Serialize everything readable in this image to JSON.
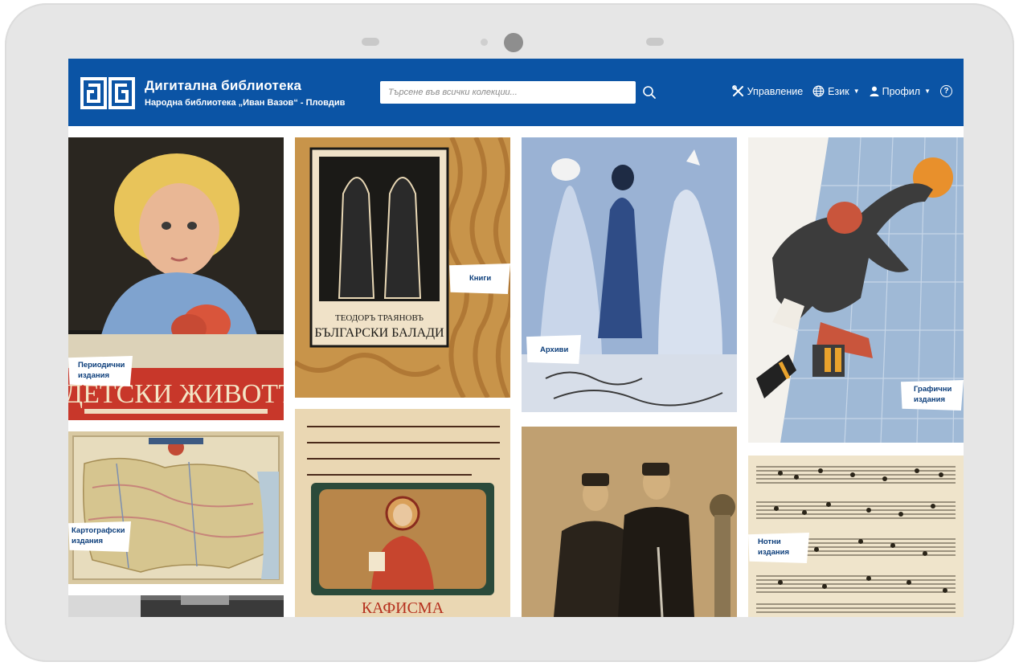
{
  "header": {
    "title": "Дигитална библиотека",
    "subtitle": "Народна библиотека „Иван Вазов“ - Пловдив",
    "search_placeholder": "Търсене във всички колекции...",
    "menu": {
      "manage": "Управление",
      "language": "Език",
      "profile": "Профил",
      "help": "?"
    }
  },
  "tiles": [
    {
      "label_line1": "Периодични",
      "label_line2": "издания"
    },
    {
      "label_line1": "Книги",
      "label_line2": ""
    },
    {
      "label_line1": "Архиви",
      "label_line2": ""
    },
    {
      "label_line1": "Графични",
      "label_line2": "издания"
    },
    {
      "label_line1": "Картографски",
      "label_line2": "издания"
    },
    {
      "label_line1": "Нотни",
      "label_line2": "издания"
    }
  ],
  "icons": {
    "logo": "library-logo-icon",
    "search": "search-icon",
    "manage": "tools-icon",
    "language": "globe-icon",
    "profile": "user-icon",
    "help": "help-icon"
  },
  "colors": {
    "navbar": "#0b54a5",
    "label_text": "#0b3d7a"
  }
}
